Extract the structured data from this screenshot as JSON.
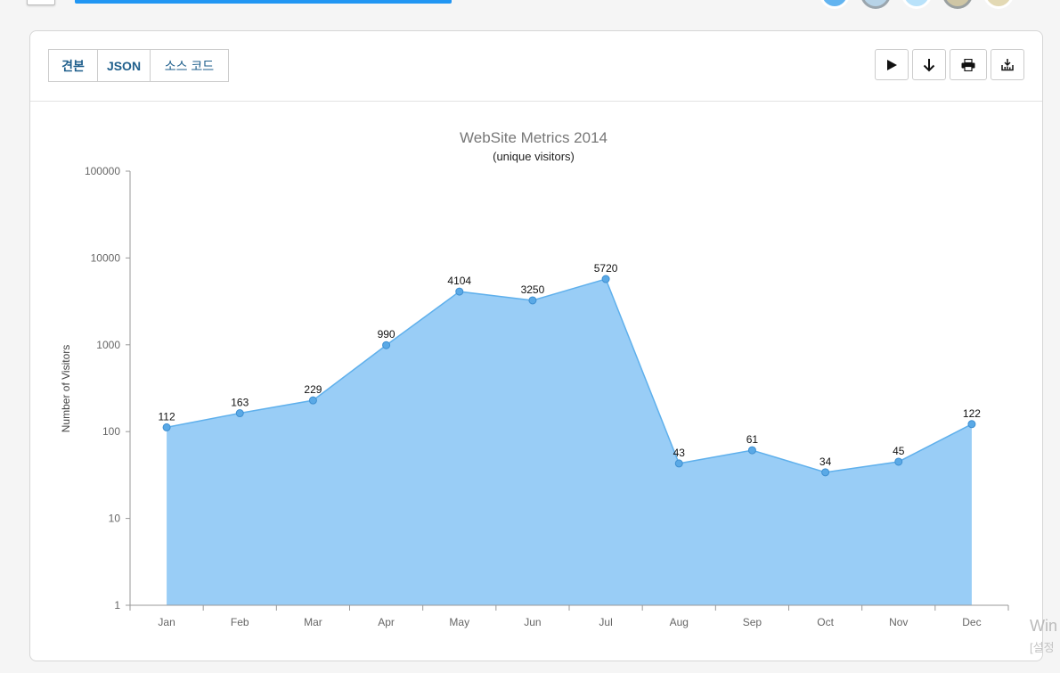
{
  "tabs": [
    {
      "label": "견본"
    },
    {
      "label": "JSON"
    },
    {
      "label": "소스 코드"
    }
  ],
  "toolbar": {
    "icons": [
      "play-icon",
      "download-arrow-icon",
      "print-icon",
      "export-icon"
    ]
  },
  "colors": {
    "area_fill": "#99cdf6",
    "line": "#5fb0ec",
    "marker": "#5aa9e6",
    "progress": "#2196f3",
    "swatches": [
      "#63b4f0",
      "#b7d3e7",
      "#b9e2fa",
      "#cfc6a5",
      "#e3d9b4"
    ]
  },
  "chart_data": {
    "type": "area",
    "title": "WebSite Metrics 2014",
    "subtitle": "(unique visitors)",
    "ylabel": "Number of Visitors",
    "xlabel": "",
    "yscale": "log",
    "ylim": [
      1,
      100000
    ],
    "yticks": [
      "1",
      "10",
      "100",
      "1000",
      "10000",
      "100000"
    ],
    "categories": [
      "Jan",
      "Feb",
      "Mar",
      "Apr",
      "May",
      "Jun",
      "Jul",
      "Aug",
      "Sep",
      "Oct",
      "Nov",
      "Dec"
    ],
    "values": [
      112,
      163,
      229,
      990,
      4104,
      3250,
      5720,
      43,
      61,
      34,
      45,
      122
    ],
    "grid": false,
    "legend": "none"
  },
  "watermark": {
    "line1": "Win",
    "line2": "[설정"
  }
}
